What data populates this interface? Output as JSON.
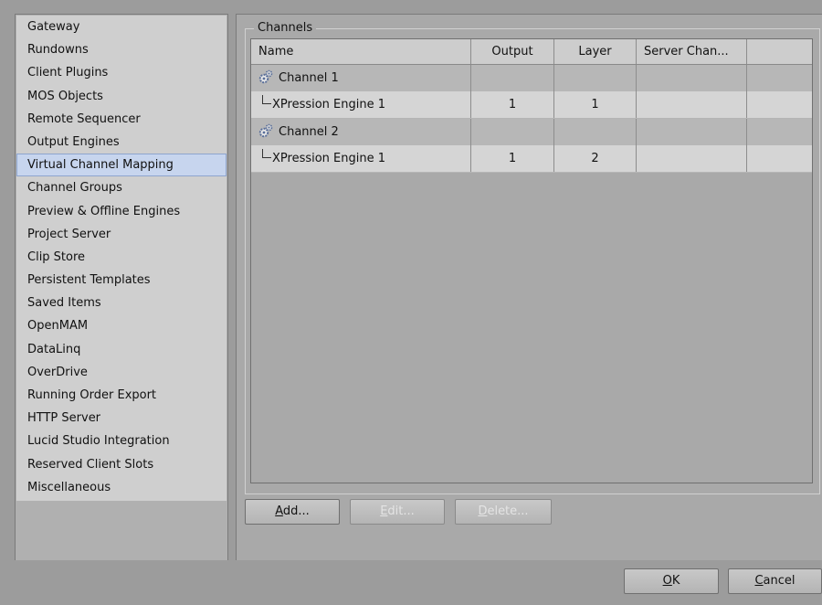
{
  "nav": {
    "items": [
      "Gateway",
      "Rundowns",
      "Client Plugins",
      "MOS Objects",
      "Remote Sequencer",
      "Output Engines",
      "Virtual Channel Mapping",
      "Channel Groups",
      "Preview & Offline Engines",
      "Project Server",
      "Clip Store",
      "Persistent Templates",
      "Saved Items",
      "OpenMAM",
      "DataLinq",
      "OverDrive",
      "Running Order Export",
      "HTTP Server",
      "Lucid Studio Integration",
      "Reserved Client Slots",
      "Miscellaneous"
    ],
    "selected": "Virtual Channel Mapping"
  },
  "channels": {
    "group_title": "Channels",
    "columns": [
      "Name",
      "Output",
      "Layer",
      "Server Chan..."
    ],
    "rows": [
      {
        "type": "channel",
        "name": "Channel 1",
        "output": "",
        "layer": "",
        "server": ""
      },
      {
        "type": "engine",
        "name": "XPression Engine 1",
        "output": "1",
        "layer": "1",
        "server": ""
      },
      {
        "type": "channel",
        "name": "Channel 2",
        "output": "",
        "layer": "",
        "server": ""
      },
      {
        "type": "engine",
        "name": "XPression Engine 1",
        "output": "1",
        "layer": "2",
        "server": ""
      }
    ]
  },
  "buttons": {
    "add_mnemonic": "A",
    "add_rest": "dd...",
    "edit_mnemonic": "E",
    "edit_rest": "dit...",
    "delete_mnemonic": "D",
    "delete_rest": "elete...",
    "ok_mnemonic": "O",
    "ok_rest": "K",
    "cancel_mnemonic": "C",
    "cancel_rest": "ancel"
  },
  "icons": {
    "channel_icon": "gear-icon",
    "tree_connector": "tree-branch-icon"
  },
  "colors": {
    "selected_bg": "#c7d5ee",
    "panel_bg": "#a9a9a9",
    "list_bg": "#cfcfcf"
  }
}
